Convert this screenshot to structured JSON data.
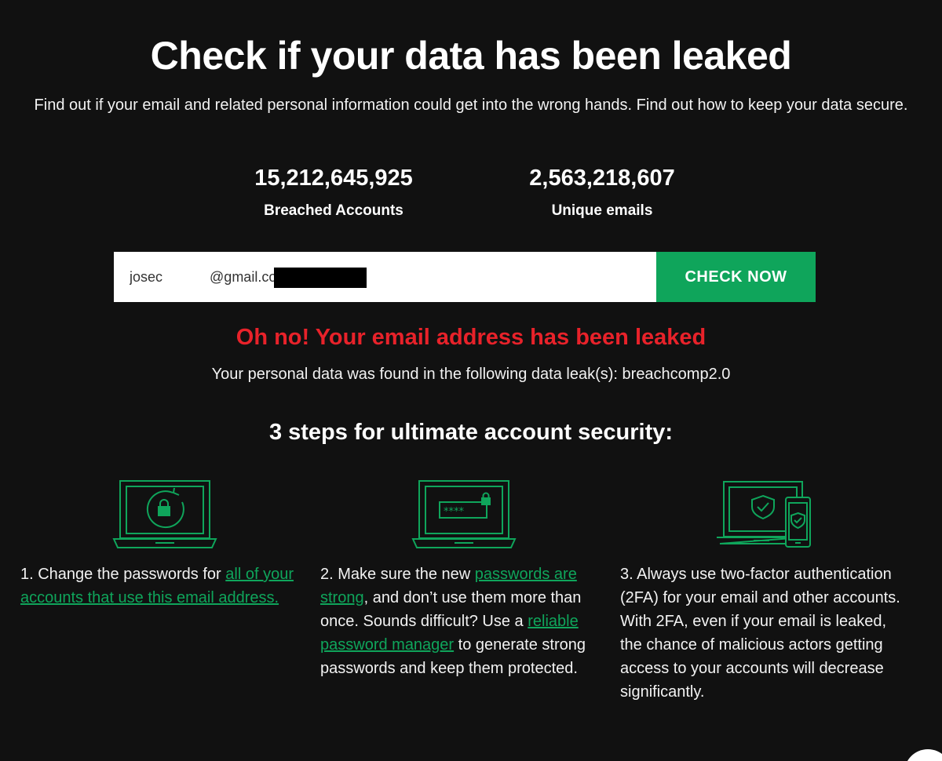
{
  "hero": {
    "title": "Check if your data has been leaked",
    "subtitle": "Find out if your email and related personal information could get into the wrong hands. Find out how to keep your data secure."
  },
  "stats": [
    {
      "value": "15,212,645,925",
      "label": "Breached Accounts"
    },
    {
      "value": "2,563,218,607",
      "label": "Unique emails"
    }
  ],
  "search": {
    "email_value": "josec            @gmail.com",
    "button_label": "CHECK NOW"
  },
  "result": {
    "title": "Oh no! Your email address has been leaked",
    "text": "Your personal data was found in the following data leak(s): breachcomp2.0"
  },
  "steps": {
    "title": "3 steps for ultimate account security:",
    "items": [
      {
        "icon": "laptop-lock-refresh-icon",
        "text_1": "1. Change the passwords for ",
        "link_1": "all of your accounts that use this email address."
      },
      {
        "icon": "laptop-password-icon",
        "text_1": "2. Make sure the new ",
        "link_1": "passwords are strong",
        "text_2": ", and don’t use them more than once. Sounds difficult? Use a ",
        "link_2": "reliable password manager",
        "text_3": " to generate strong passwords and keep them protected."
      },
      {
        "icon": "laptop-phone-shield-icon",
        "text_1": "3. Always use two-factor authentication (2FA) for your email and other accounts. With 2FA, even if your email is leaked, the chance of malicious actors getting access to your accounts will decrease significantly."
      }
    ]
  },
  "colors": {
    "background": "#111111",
    "accent_green": "#0fa55b",
    "alert_red": "#e8222a",
    "text": "#ffffff"
  }
}
